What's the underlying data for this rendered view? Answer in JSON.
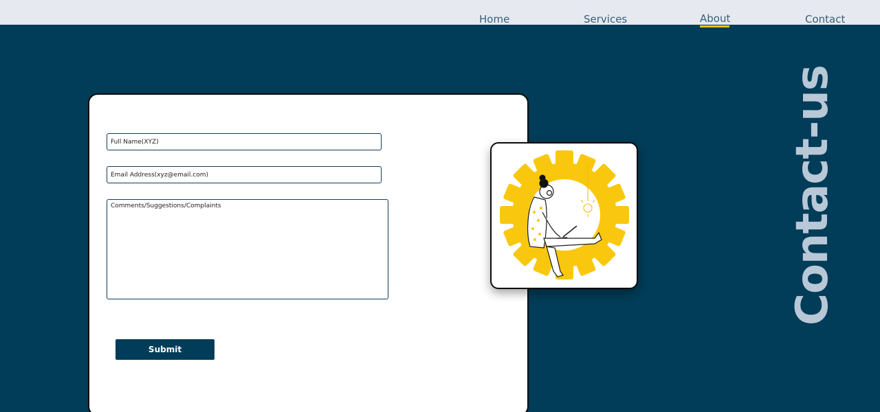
{
  "nav": {
    "items": [
      {
        "label": "Home"
      },
      {
        "label": "Services"
      },
      {
        "label": "About"
      },
      {
        "label": "Contact"
      }
    ],
    "active": "About"
  },
  "form": {
    "name_placeholder": "Full Name(XYZ)",
    "email_placeholder": "Email Address(xyz@email.com)",
    "comments_placeholder": "Comments/Suggestions/Complaints",
    "submit_label": "Submit"
  },
  "page": {
    "vertical_title": "Contact-us"
  },
  "colors": {
    "background": "#013c58",
    "topbar": "#e6eaf0",
    "accent": "#f5c400",
    "title_text": "#b8c8d6",
    "button": "#013c58"
  },
  "illustration": {
    "icon": "person-with-laptop-in-gear-illustration"
  }
}
